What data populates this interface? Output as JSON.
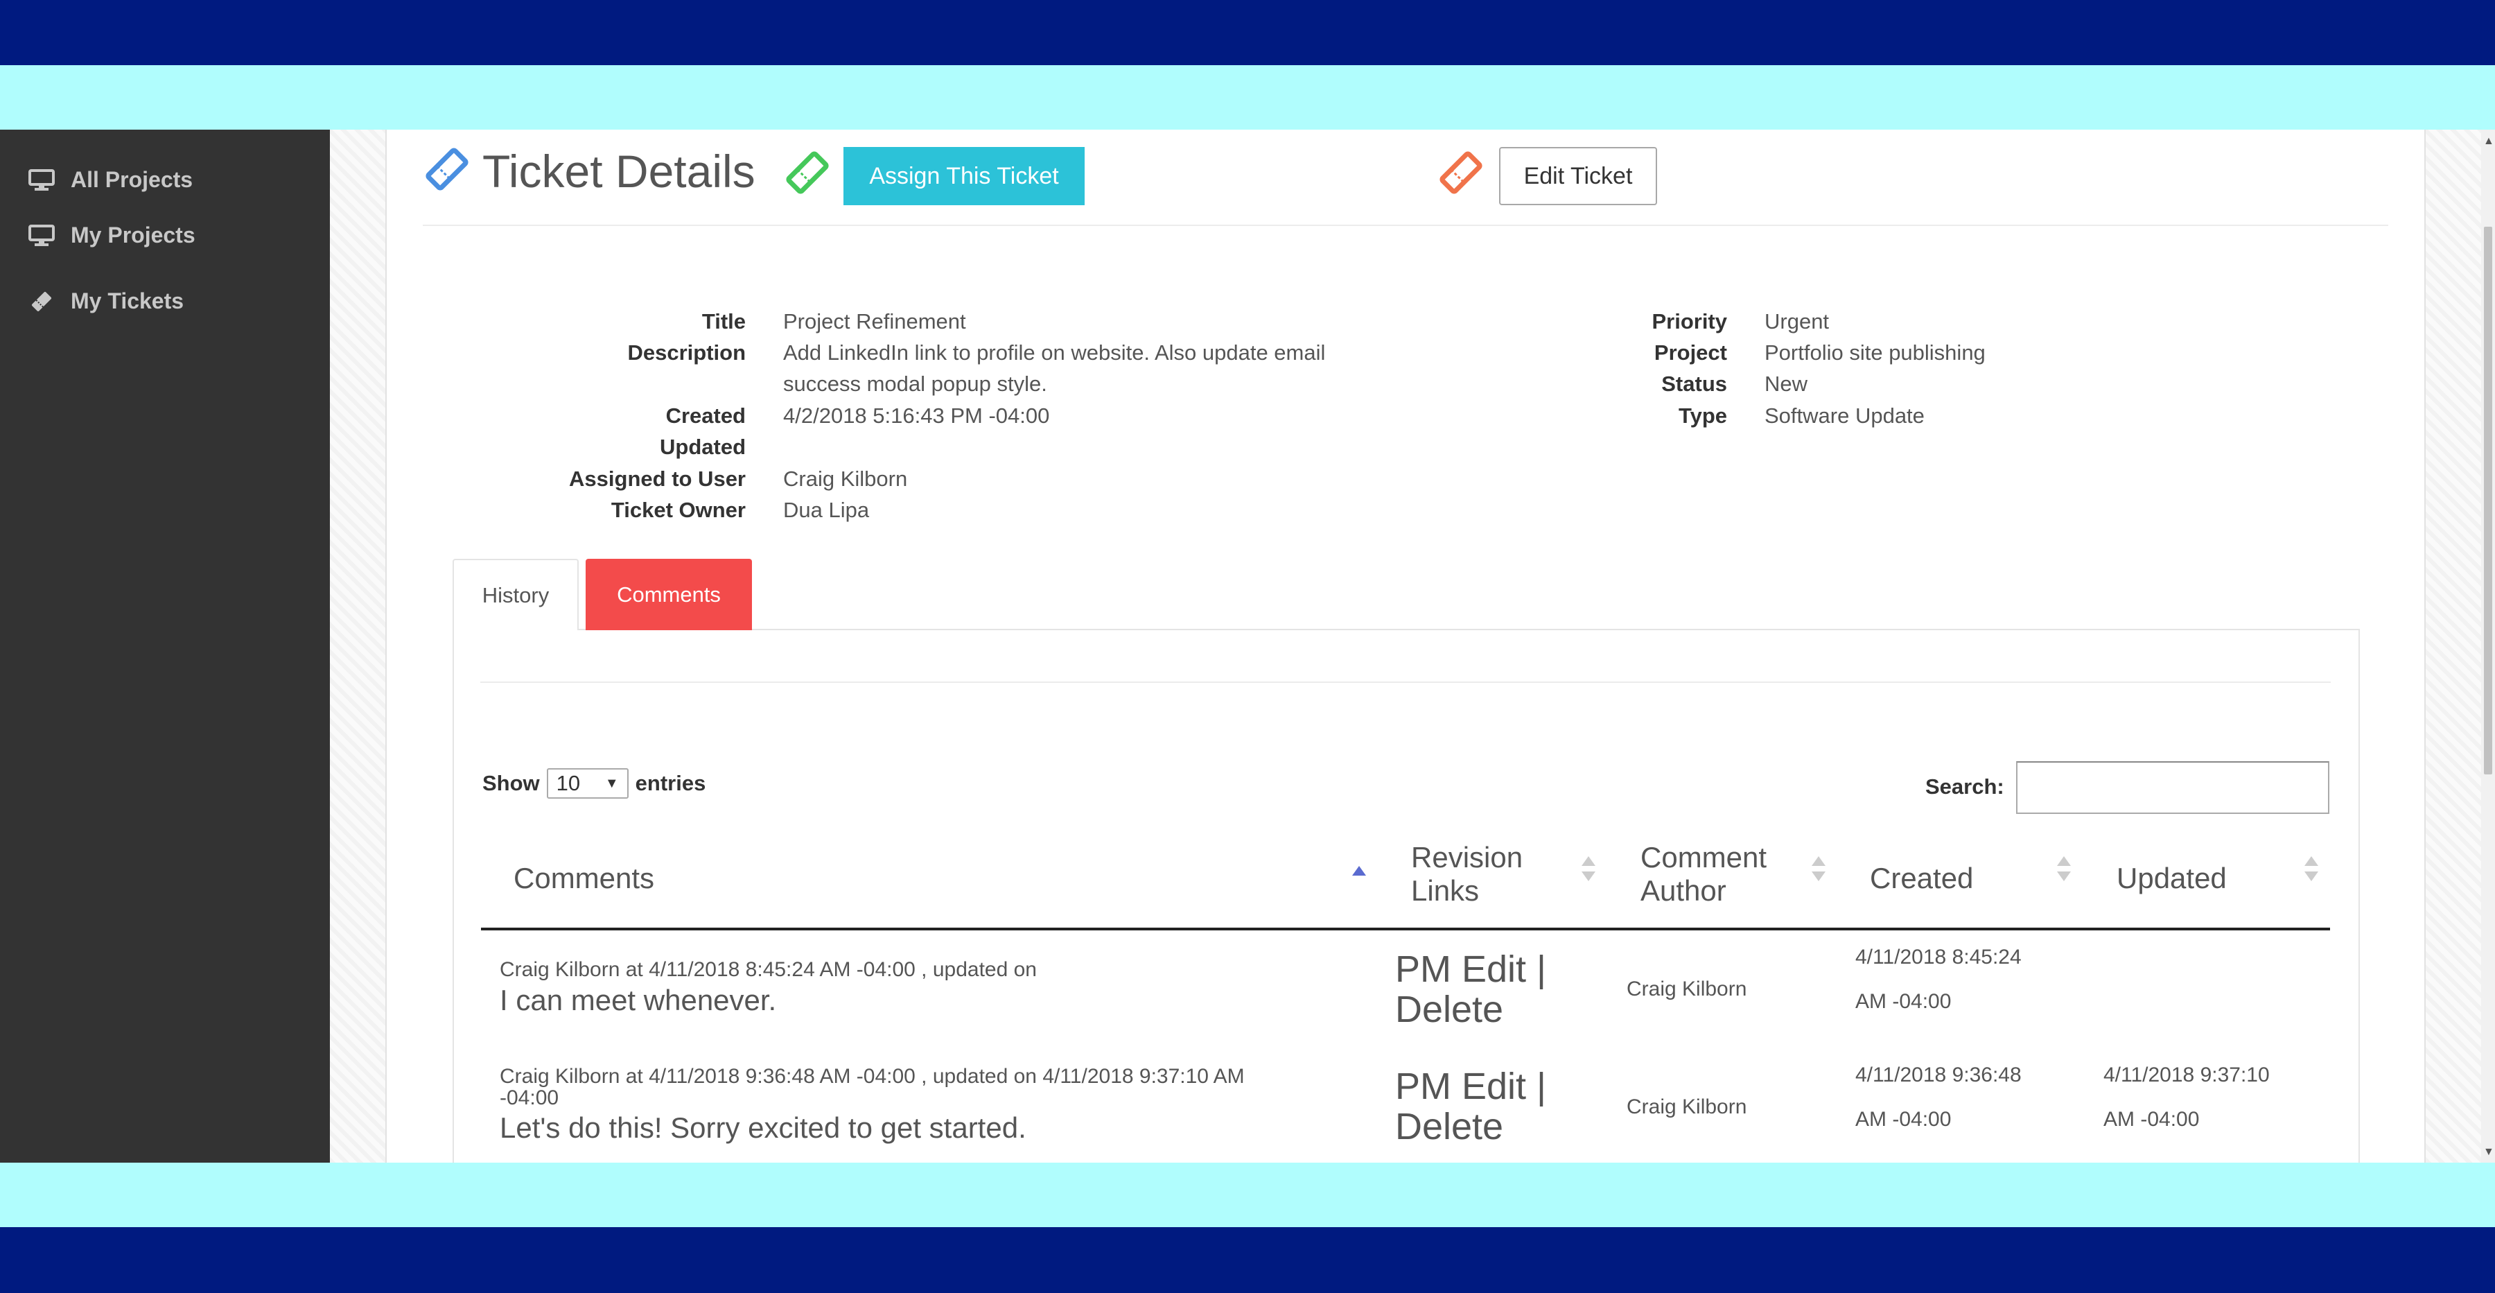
{
  "sidebar": {
    "items": [
      {
        "label": "All Projects",
        "icon": "monitor-icon"
      },
      {
        "label": "My Projects",
        "icon": "monitor-icon"
      },
      {
        "label": "My Tickets",
        "icon": "ticket-icon"
      }
    ]
  },
  "header": {
    "title": "Ticket Details",
    "assign_label": "Assign This Ticket",
    "edit_label": "Edit Ticket",
    "icon_colors": {
      "title": "#4a8fe0",
      "assign": "#45c85a",
      "edit": "#f0734a"
    }
  },
  "details_left": [
    {
      "key": "Title",
      "value": "Project Refinement"
    },
    {
      "key": "Description",
      "value": "Add LinkedIn link to profile on website. Also update email",
      "value2": "success modal popup style."
    },
    {
      "key": "Created",
      "value": "4/2/2018 5:16:43 PM -04:00"
    },
    {
      "key": "Updated",
      "value": ""
    },
    {
      "key": "Assigned to User",
      "value": "Craig Kilborn"
    },
    {
      "key": "Ticket Owner",
      "value": "Dua Lipa"
    }
  ],
  "details_right": [
    {
      "key": "Priority",
      "value": "Urgent"
    },
    {
      "key": "Project",
      "value": "Portfolio site publishing"
    },
    {
      "key": "Status",
      "value": "New"
    },
    {
      "key": "Type",
      "value": "Software Update"
    }
  ],
  "tabs": [
    {
      "label": "History"
    },
    {
      "label": "Comments"
    }
  ],
  "table_controls": {
    "show_label": "Show",
    "page_size": "10",
    "entries_label": "entries",
    "search_label": "Search:",
    "search_value": ""
  },
  "table": {
    "columns": [
      {
        "line1": "Comments",
        "line2": ""
      },
      {
        "line1": "Revision",
        "line2": "Links"
      },
      {
        "line1": "Comment",
        "line2": "Author"
      },
      {
        "line1": "Created",
        "line2": ""
      },
      {
        "line1": "Updated",
        "line2": ""
      }
    ],
    "rows": [
      {
        "meta1": "Craig Kilborn at 4/11/2018 8:45:24 AM -04:00 , updated on",
        "meta2": "",
        "body": "I can meet whenever.",
        "links1": "PM Edit |",
        "links2": "Delete",
        "author": "Craig Kilborn",
        "created1": "4/11/2018 8:45:24",
        "created2": "AM -04:00",
        "updated1": "",
        "updated2": ""
      },
      {
        "meta1": "Craig Kilborn at 4/11/2018 9:36:48 AM -04:00 , updated on 4/11/2018 9:37:10 AM",
        "meta2": "-04:00",
        "body": "Let's do this! Sorry excited to get started.",
        "links1": "PM Edit |",
        "links2": "Delete",
        "author": "Craig Kilborn",
        "created1": "4/11/2018 9:36:48",
        "created2": "AM -04:00",
        "updated1": "4/11/2018 9:37:10",
        "updated2": "AM -04:00"
      }
    ]
  }
}
